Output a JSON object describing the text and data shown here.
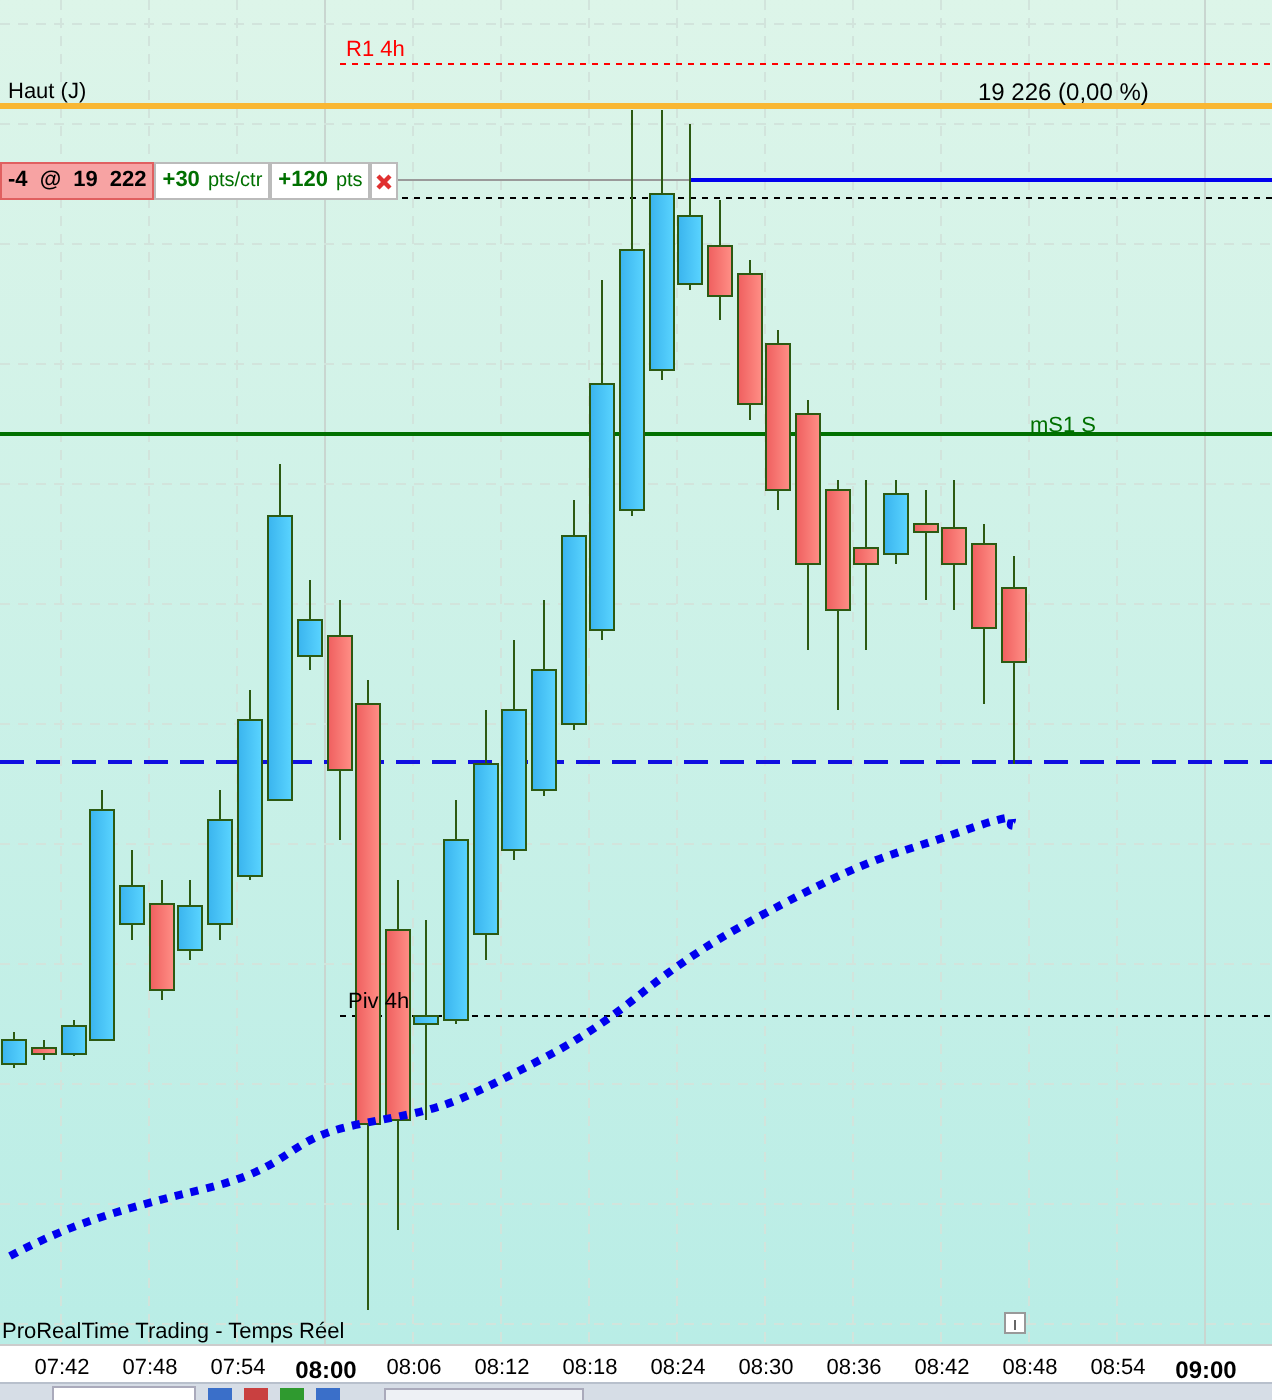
{
  "levels": {
    "r1_label": "R1 4h",
    "high_label": "Haut (J)",
    "high_value": "19 226 (0,00 %)",
    "ms1_label": "mS1 S",
    "pivot_label": "Piv 4h"
  },
  "order_ticket": {
    "position": "-4 @ 19 222",
    "per_contract": "+30",
    "per_contract_unit": "pts/ctr",
    "total": "+120",
    "total_unit": "pts"
  },
  "footer": {
    "source": "ProRealTime Trading - Temps Réel"
  },
  "time_axis": [
    {
      "label": "07:42",
      "major": false
    },
    {
      "label": "07:48",
      "major": false
    },
    {
      "label": "07:54",
      "major": false
    },
    {
      "label": "08:00",
      "major": true
    },
    {
      "label": "08:06",
      "major": false
    },
    {
      "label": "08:12",
      "major": false
    },
    {
      "label": "08:18",
      "major": false
    },
    {
      "label": "08:24",
      "major": false
    },
    {
      "label": "08:30",
      "major": false
    },
    {
      "label": "08:36",
      "major": false
    },
    {
      "label": "08:42",
      "major": false
    },
    {
      "label": "08:48",
      "major": false
    },
    {
      "label": "08:54",
      "major": false
    },
    {
      "label": "09:00",
      "major": true
    }
  ]
}
